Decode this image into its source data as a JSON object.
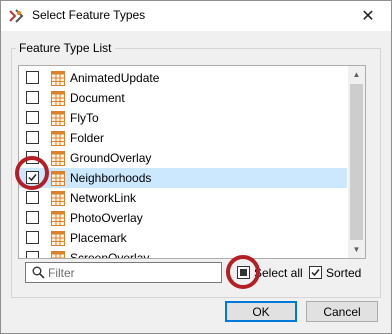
{
  "window": {
    "title": "Select Feature Types",
    "close_glyph": "✕",
    "app_icon": "fme-workbench-icon",
    "close_icon": "close-icon"
  },
  "group": {
    "label": "Feature Type List"
  },
  "feature_types": [
    {
      "label": "AnimatedUpdate",
      "checked": false,
      "selected": false
    },
    {
      "label": "Document",
      "checked": false,
      "selected": false
    },
    {
      "label": "FlyTo",
      "checked": false,
      "selected": false
    },
    {
      "label": "Folder",
      "checked": false,
      "selected": false
    },
    {
      "label": "GroundOverlay",
      "checked": false,
      "selected": false
    },
    {
      "label": "Neighborhoods",
      "checked": true,
      "selected": true
    },
    {
      "label": "NetworkLink",
      "checked": false,
      "selected": false
    },
    {
      "label": "PhotoOverlay",
      "checked": false,
      "selected": false
    },
    {
      "label": "Placemark",
      "checked": false,
      "selected": false
    },
    {
      "label": "ScreenOverlay",
      "checked": false,
      "selected": false
    }
  ],
  "scrollbar": {
    "up_glyph": "▲",
    "down_glyph": "▼"
  },
  "filter": {
    "placeholder": "Filter",
    "value": "",
    "icon": "search-icon"
  },
  "select_all": {
    "label": "Select all",
    "state": "indeterminate"
  },
  "sorted": {
    "label": "Sorted",
    "checked": true
  },
  "buttons": {
    "ok": "OK",
    "cancel": "Cancel"
  },
  "colors": {
    "selection": "#cce8ff",
    "highlight_ring": "#b31f24",
    "default_button_border": "#0078d7",
    "feature_icon_orange": "#d9822b"
  }
}
